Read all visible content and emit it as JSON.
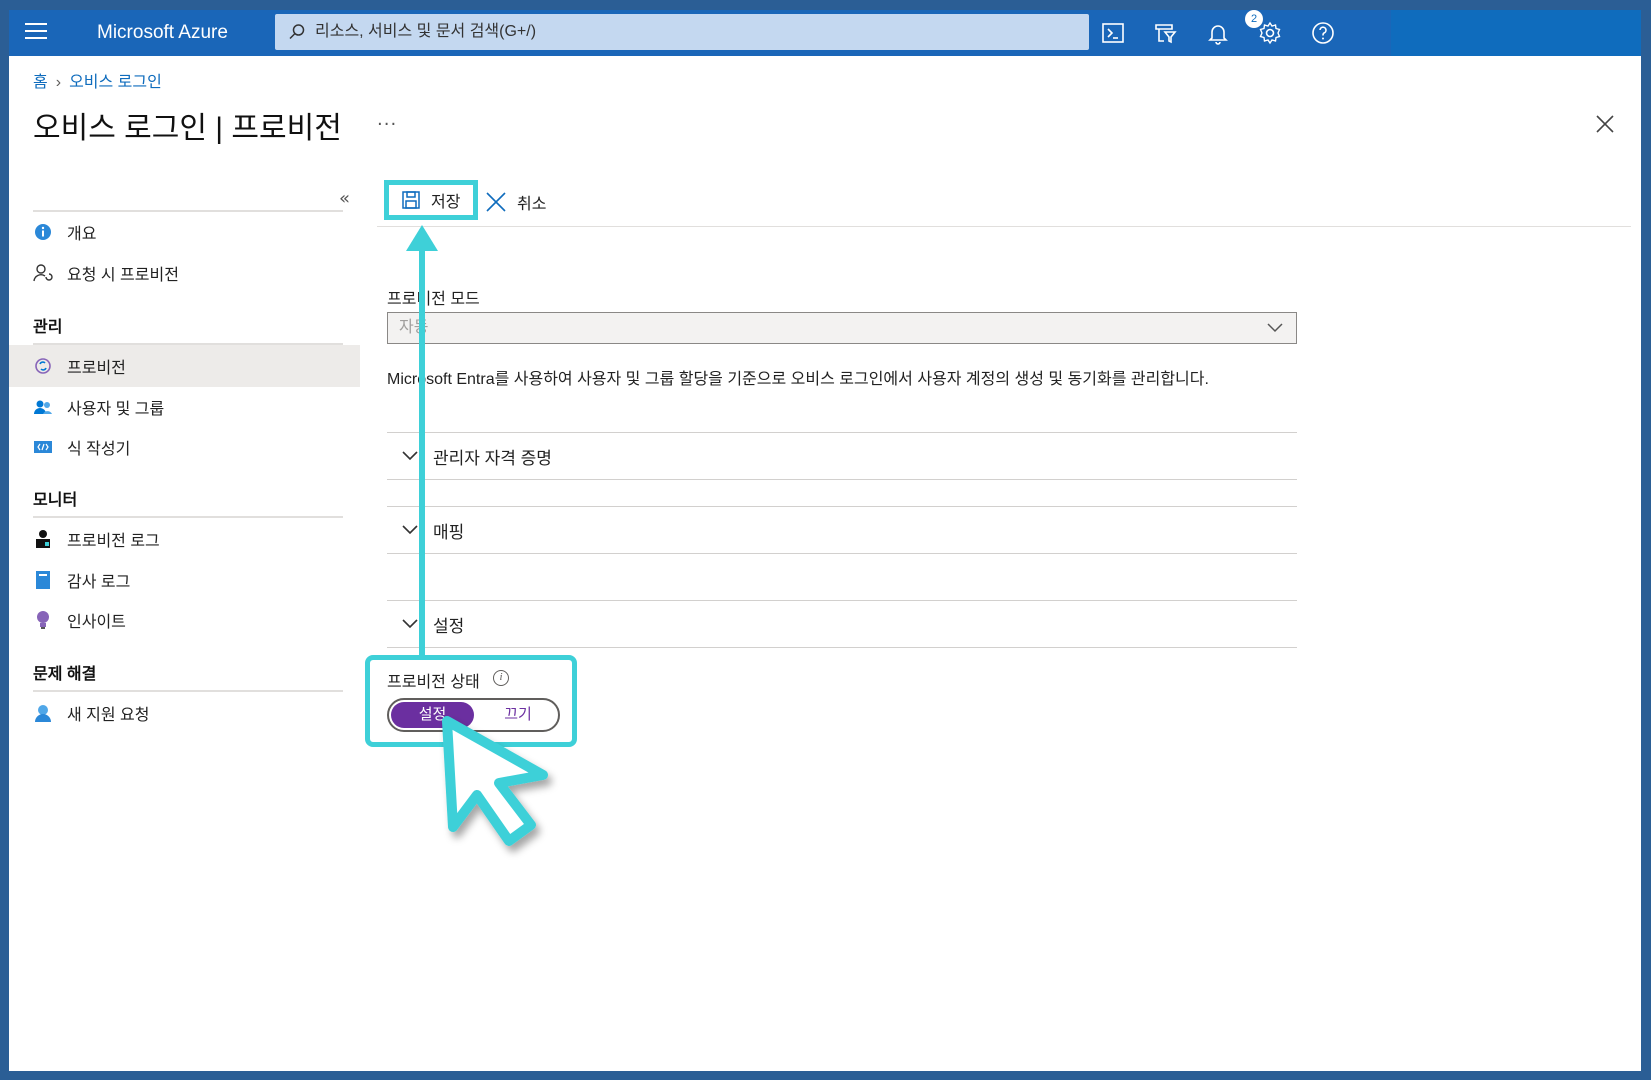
{
  "app": {
    "brand": "Microsoft Azure"
  },
  "search": {
    "placeholder": "리소스, 서비스 및 문서 검색(G+/)"
  },
  "toolbar_icons": [
    "cloud-shell-icon",
    "directory-filter-icon",
    "notifications-icon",
    "settings-icon",
    "help-icon"
  ],
  "notifications": {
    "count": "2"
  },
  "breadcrumb": {
    "home": "홈",
    "current": "오비스 로그인"
  },
  "page": {
    "title": "오비스 로그인 | 프로비전",
    "more": "···"
  },
  "nav": {
    "items_top": [
      {
        "label": "개요",
        "icon": "info-icon"
      },
      {
        "label": "요청 시 프로비전",
        "icon": "user-sync-icon"
      }
    ],
    "groups": [
      {
        "title": "관리",
        "items": [
          {
            "label": "프로비전",
            "icon": "provisioning-icon",
            "active": true
          },
          {
            "label": "사용자 및 그룹",
            "icon": "users-groups-icon"
          },
          {
            "label": "식 작성기",
            "icon": "expression-builder-icon"
          }
        ]
      },
      {
        "title": "모니터",
        "items": [
          {
            "label": "프로비전 로그",
            "icon": "provisioning-log-icon"
          },
          {
            "label": "감사 로그",
            "icon": "audit-log-icon"
          },
          {
            "label": "인사이트",
            "icon": "insights-icon"
          }
        ]
      },
      {
        "title": "문제 해결",
        "items": [
          {
            "label": "새 지원 요청",
            "icon": "support-request-icon"
          }
        ]
      }
    ]
  },
  "command_bar": {
    "save": "저장",
    "cancel": "취소"
  },
  "form": {
    "mode_label": "프로비전 모드",
    "mode_value": "자동",
    "description": "Microsoft Entra를 사용하여 사용자 및 그룹 할당을 기준으로 오비스 로그인에서 사용자 계정의 생성 및 동기화를 관리합니다.",
    "sections": [
      "관리자 자격 증명",
      "매핑",
      "설정"
    ],
    "status_label": "프로비전 상태",
    "status_on": "설정",
    "status_off": "끄기",
    "status_value": "설정"
  },
  "colors": {
    "accent": "#0f6cbd",
    "highlight": "#3ed0d8",
    "toggle_on": "#6b2fa0"
  }
}
